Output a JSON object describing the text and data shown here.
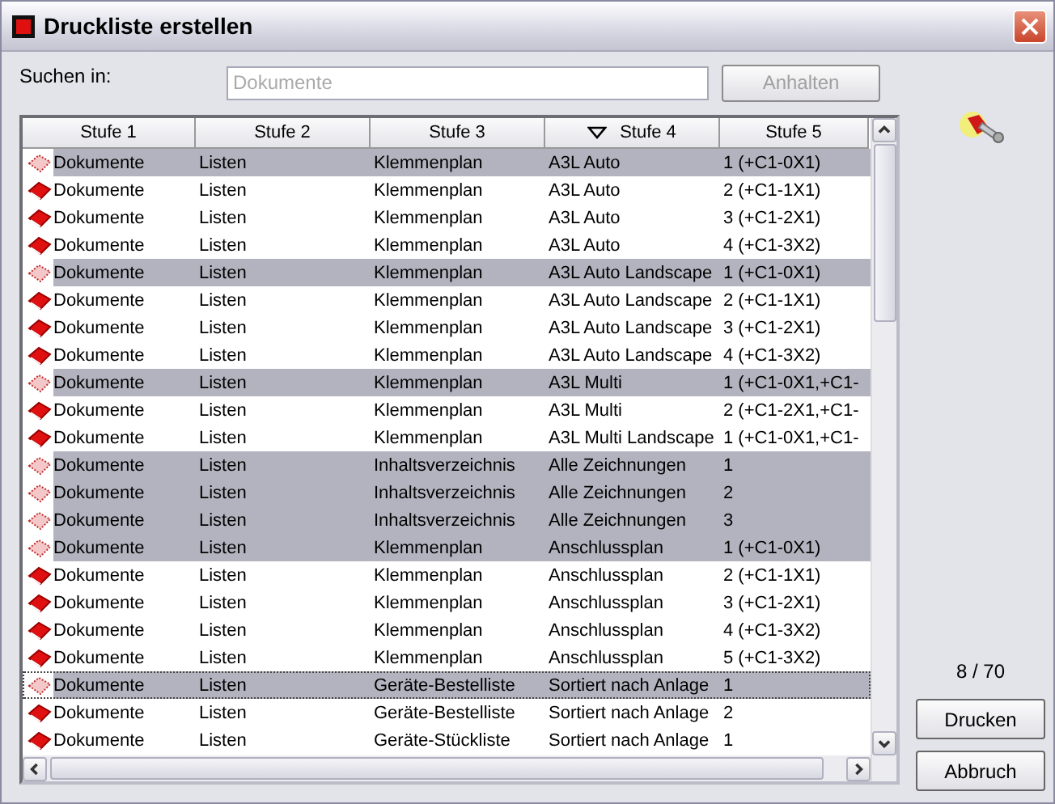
{
  "window": {
    "title": "Druckliste erstellen"
  },
  "search": {
    "label": "Suchen in:",
    "placeholder": "Dokumente",
    "button": {
      "label": "Anhalten",
      "disabled": true
    }
  },
  "table": {
    "columns": [
      {
        "label": "Stufe 1",
        "sorted": false
      },
      {
        "label": "Stufe 2",
        "sorted": false
      },
      {
        "label": "Stufe 3",
        "sorted": false
      },
      {
        "label": "Stufe 4",
        "sorted": true
      },
      {
        "label": "Stufe 5",
        "sorted": false
      }
    ],
    "rows": [
      {
        "selected": true,
        "focused": false,
        "cells": [
          "Dokumente",
          "Listen",
          "Klemmenplan",
          "A3L Auto",
          "1 (+C1-0X1)"
        ]
      },
      {
        "selected": false,
        "focused": false,
        "cells": [
          "Dokumente",
          "Listen",
          "Klemmenplan",
          "A3L Auto",
          "2 (+C1-1X1)"
        ]
      },
      {
        "selected": false,
        "focused": false,
        "cells": [
          "Dokumente",
          "Listen",
          "Klemmenplan",
          "A3L Auto",
          "3 (+C1-2X1)"
        ]
      },
      {
        "selected": false,
        "focused": false,
        "cells": [
          "Dokumente",
          "Listen",
          "Klemmenplan",
          "A3L Auto",
          "4 (+C1-3X2)"
        ]
      },
      {
        "selected": true,
        "focused": false,
        "cells": [
          "Dokumente",
          "Listen",
          "Klemmenplan",
          "A3L Auto Landscape",
          "1 (+C1-0X1)"
        ]
      },
      {
        "selected": false,
        "focused": false,
        "cells": [
          "Dokumente",
          "Listen",
          "Klemmenplan",
          "A3L Auto Landscape",
          "2 (+C1-1X1)"
        ]
      },
      {
        "selected": false,
        "focused": false,
        "cells": [
          "Dokumente",
          "Listen",
          "Klemmenplan",
          "A3L Auto Landscape",
          "3 (+C1-2X1)"
        ]
      },
      {
        "selected": false,
        "focused": false,
        "cells": [
          "Dokumente",
          "Listen",
          "Klemmenplan",
          "A3L Auto Landscape",
          "4 (+C1-3X2)"
        ]
      },
      {
        "selected": true,
        "focused": false,
        "cells": [
          "Dokumente",
          "Listen",
          "Klemmenplan",
          "A3L Multi",
          "1 (+C1-0X1,+C1-"
        ]
      },
      {
        "selected": false,
        "focused": false,
        "cells": [
          "Dokumente",
          "Listen",
          "Klemmenplan",
          "A3L Multi",
          "2 (+C1-2X1,+C1-"
        ]
      },
      {
        "selected": false,
        "focused": false,
        "cells": [
          "Dokumente",
          "Listen",
          "Klemmenplan",
          "A3L Multi Landscape",
          "1 (+C1-0X1,+C1-"
        ]
      },
      {
        "selected": true,
        "focused": false,
        "cells": [
          "Dokumente",
          "Listen",
          "Inhaltsverzeichnis",
          "Alle Zeichnungen",
          "1"
        ]
      },
      {
        "selected": true,
        "focused": false,
        "cells": [
          "Dokumente",
          "Listen",
          "Inhaltsverzeichnis",
          "Alle Zeichnungen",
          "2"
        ]
      },
      {
        "selected": true,
        "focused": false,
        "cells": [
          "Dokumente",
          "Listen",
          "Inhaltsverzeichnis",
          "Alle Zeichnungen",
          "3"
        ]
      },
      {
        "selected": true,
        "focused": false,
        "cells": [
          "Dokumente",
          "Listen",
          "Klemmenplan",
          "Anschlussplan",
          "1 (+C1-0X1)"
        ]
      },
      {
        "selected": false,
        "focused": false,
        "cells": [
          "Dokumente",
          "Listen",
          "Klemmenplan",
          "Anschlussplan",
          "2 (+C1-1X1)"
        ]
      },
      {
        "selected": false,
        "focused": false,
        "cells": [
          "Dokumente",
          "Listen",
          "Klemmenplan",
          "Anschlussplan",
          "3 (+C1-2X1)"
        ]
      },
      {
        "selected": false,
        "focused": false,
        "cells": [
          "Dokumente",
          "Listen",
          "Klemmenplan",
          "Anschlussplan",
          "4 (+C1-3X2)"
        ]
      },
      {
        "selected": false,
        "focused": false,
        "cells": [
          "Dokumente",
          "Listen",
          "Klemmenplan",
          "Anschlussplan",
          "5 (+C1-3X2)"
        ]
      },
      {
        "selected": true,
        "focused": true,
        "cells": [
          "Dokumente",
          "Listen",
          "Geräte-Bestelliste",
          "Sortiert nach Anlage",
          "1"
        ]
      },
      {
        "selected": false,
        "focused": false,
        "cells": [
          "Dokumente",
          "Listen",
          "Geräte-Bestelliste",
          "Sortiert nach Anlage",
          "2"
        ]
      },
      {
        "selected": false,
        "focused": false,
        "cells": [
          "Dokumente",
          "Listen",
          "Geräte-Stückliste",
          "Sortiert nach Anlage",
          "1"
        ]
      }
    ]
  },
  "counter": "8 / 70",
  "buttons": [
    {
      "label": "Drucken"
    },
    {
      "label": "Abbruch"
    }
  ]
}
